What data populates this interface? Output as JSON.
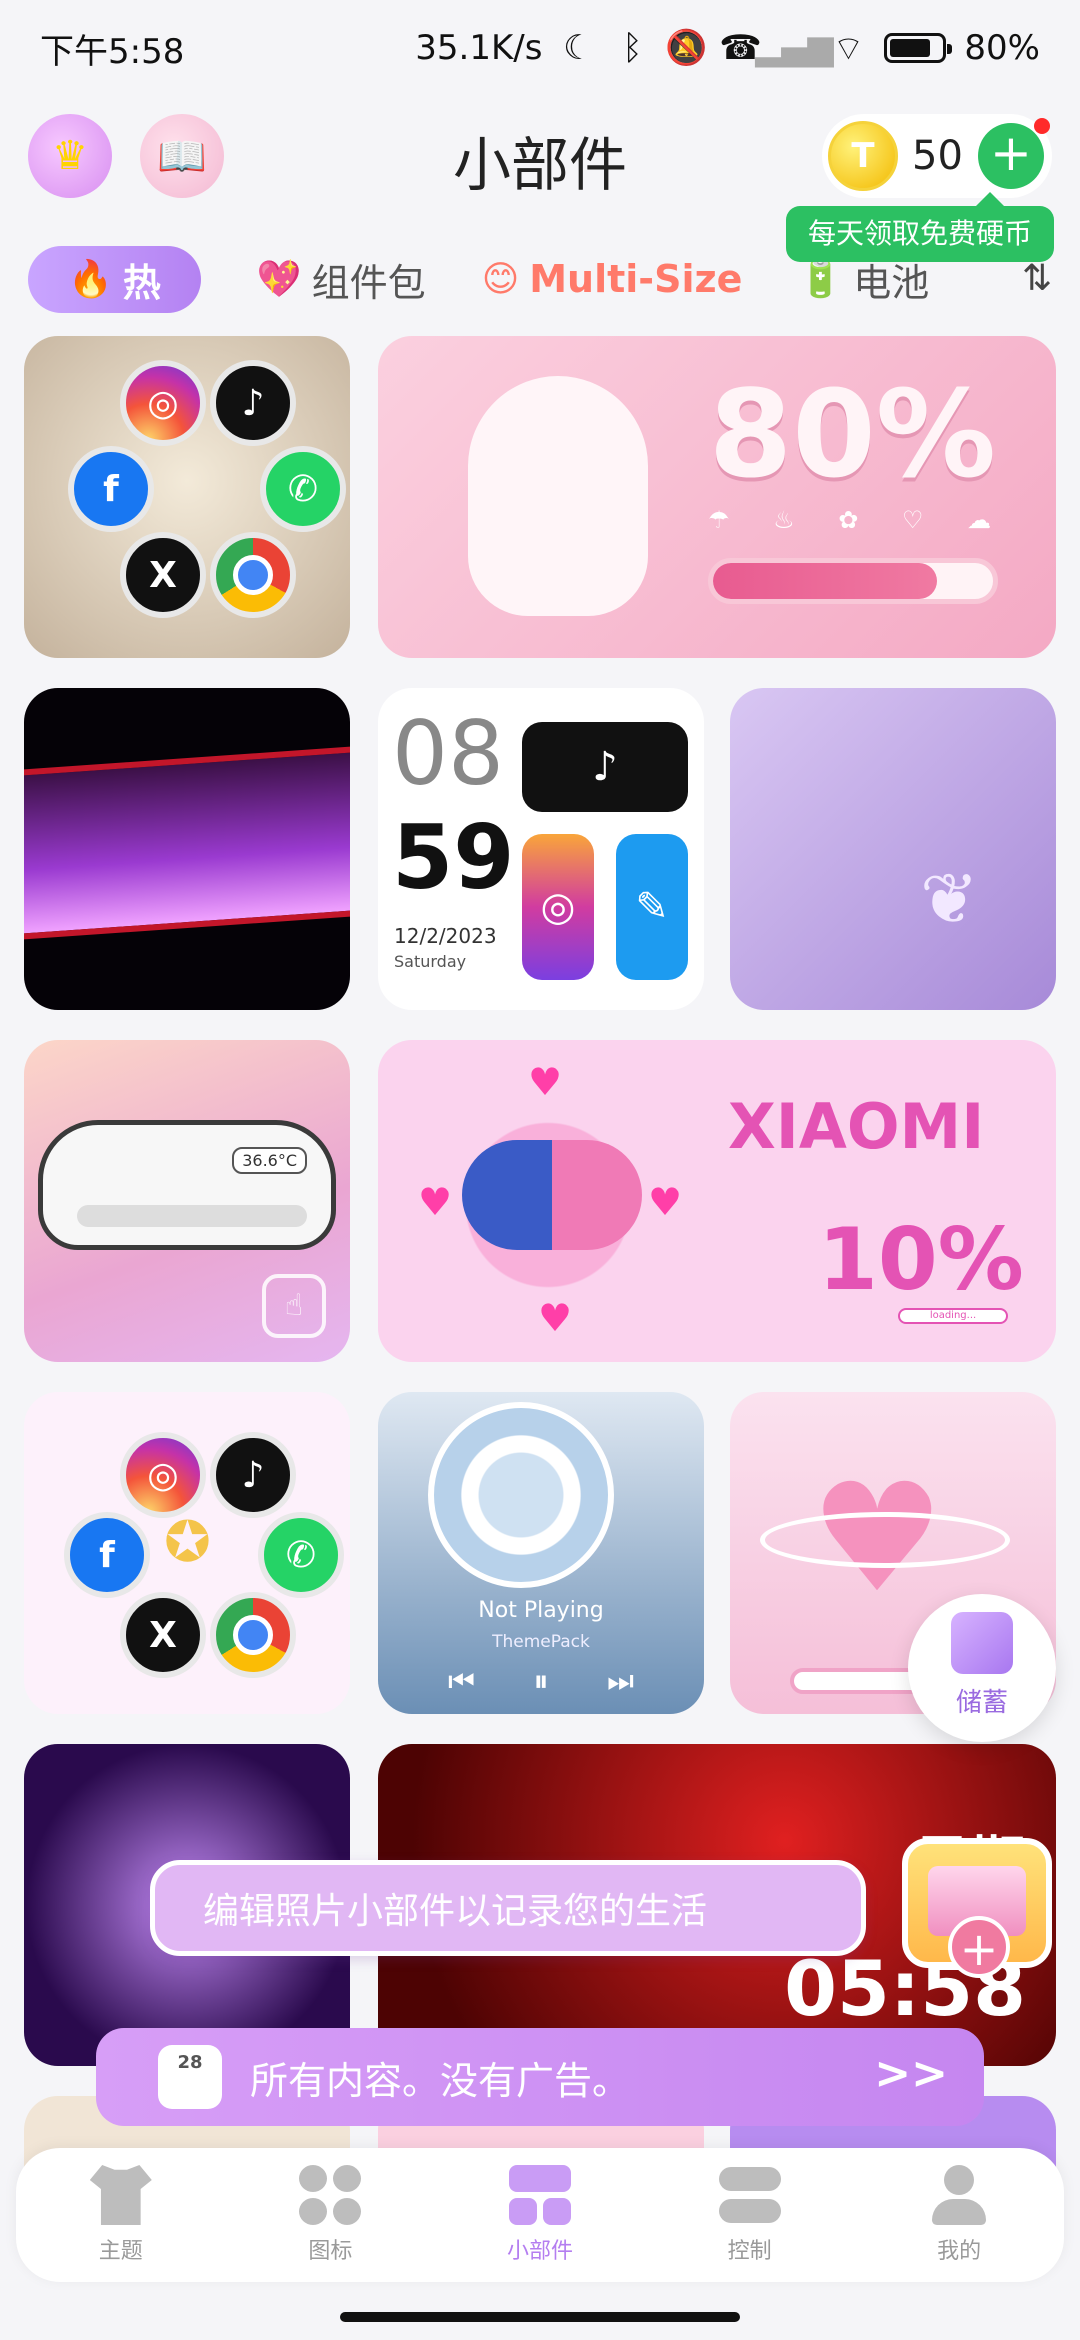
{
  "status_bar": {
    "time": "下午5:58",
    "network_speed": "35.1K/s",
    "battery_pct": "80%",
    "battery_level": 0.8,
    "icons": [
      "moon-icon",
      "bluetooth-icon",
      "mute-bell-icon",
      "call-icon",
      "signal-icon",
      "wifi-icon",
      "battery-icon"
    ]
  },
  "header": {
    "title": "小部件",
    "coin_count": "50",
    "coin_symbol": "T",
    "add_symbol": "+",
    "free_coin_tip": "每天领取免费硬币"
  },
  "tabs": [
    {
      "emoji": "🔥",
      "label": "热"
    },
    {
      "emoji": "💖",
      "label": "组件包"
    },
    {
      "emoji": "😊",
      "label": "Multi-Size"
    },
    {
      "emoji": "🔋",
      "label": "电池"
    }
  ],
  "widgets": {
    "bunny_battery": "80%",
    "clock_hour": "08",
    "clock_minute": "59",
    "clock_date": "12/2/2023",
    "clock_day": "Saturday",
    "cat_temp": "36.6°C",
    "xiaomi_brand": "XIAOMI",
    "xiaomi_pct": "10%",
    "xiaomi_loading": "loading...",
    "music_title": "Not Playing",
    "music_subtitle": "ThemePack",
    "red_week": "星期",
    "red_time": "05:58"
  },
  "floating": {
    "storage_label": "储蓄",
    "photo_banner": "编辑照片小部件以记录您的生活",
    "adfree_text": "所有内容。没有广告。",
    "adfree_app_date": "28",
    "adfree_arrow": ">>"
  },
  "bottom_nav": [
    {
      "label": "主题",
      "icon": "theme-shirt-icon"
    },
    {
      "label": "图标",
      "icon": "icons-clover-icon"
    },
    {
      "label": "小部件",
      "icon": "widgets-icon",
      "active": true
    },
    {
      "label": "控制",
      "icon": "control-toggle-icon"
    },
    {
      "label": "我的",
      "icon": "profile-icon"
    }
  ],
  "colors": {
    "accent": "#b47ef0",
    "coin_green": "#2cc062",
    "multi_size": "#ff7a6a"
  }
}
